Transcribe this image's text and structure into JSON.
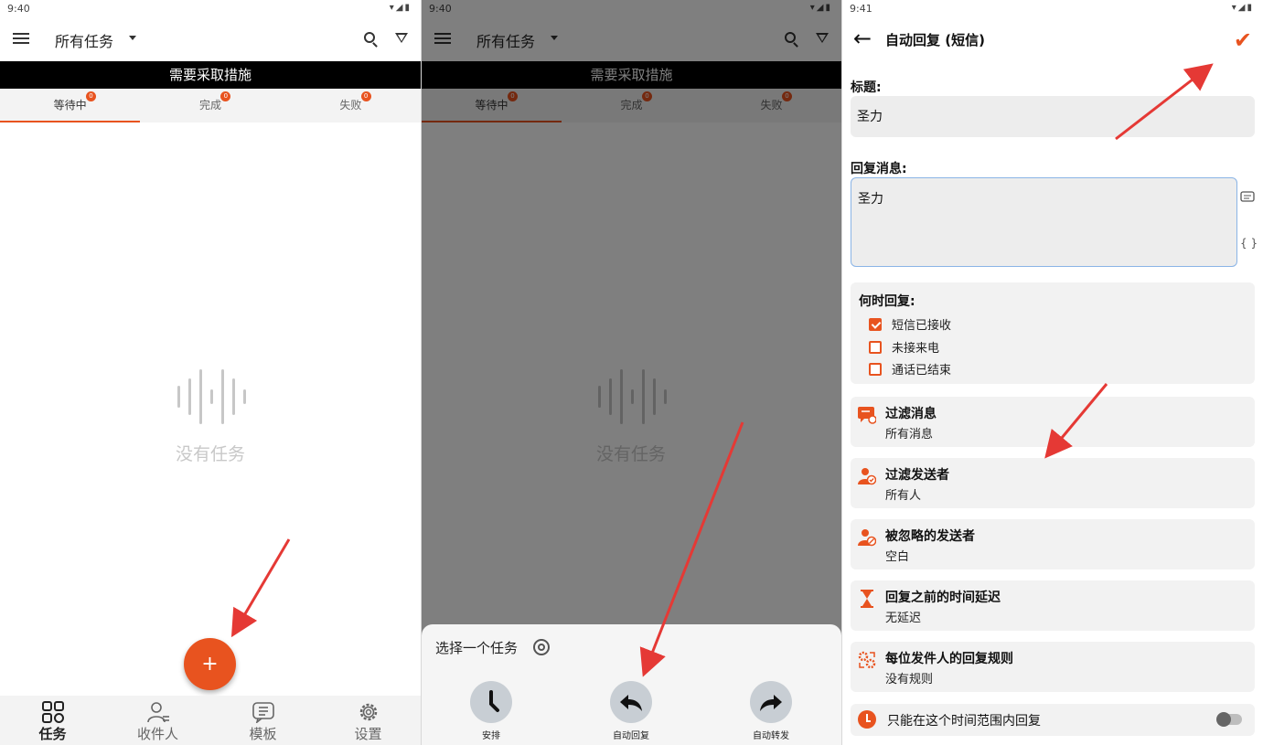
{
  "colors": {
    "accent": "#e8531f",
    "arrow": "#e53935"
  },
  "screen1": {
    "time": "9:40",
    "title": "所有任务",
    "action_banner": "需要采取措施",
    "tabs": [
      {
        "label": "等待中",
        "count": "0",
        "active": true
      },
      {
        "label": "完成",
        "count": "0"
      },
      {
        "label": "失败",
        "count": "0"
      }
    ],
    "empty_text": "没有任务",
    "fab": "+",
    "nav": [
      {
        "label": "任务",
        "icon": "grid-icon",
        "active": true
      },
      {
        "label": "收件人",
        "icon": "recipient-icon"
      },
      {
        "label": "模板",
        "icon": "template-icon"
      },
      {
        "label": "设置",
        "icon": "gear-icon"
      }
    ]
  },
  "screen2": {
    "time": "9:40",
    "title": "所有任务",
    "action_banner": "需要采取措施",
    "tabs": [
      {
        "label": "等待中",
        "count": "0"
      },
      {
        "label": "完成",
        "count": "0"
      },
      {
        "label": "失败",
        "count": "0"
      }
    ],
    "empty_text": "没有任务",
    "sheet_title": "选择一个任务",
    "sheet_options": [
      {
        "label": "安排",
        "icon": "clock-icon"
      },
      {
        "label": "自动回复",
        "icon": "reply-icon"
      },
      {
        "label": "自动转发",
        "icon": "forward-icon"
      }
    ]
  },
  "screen3": {
    "time": "9:41",
    "title": "自动回复 (短信)",
    "title_label": "标题:",
    "title_value": "圣力",
    "message_label": "回复消息:",
    "message_value": "圣力",
    "side_icon_2": "{ }",
    "when_label": "何时回复:",
    "when_options": [
      {
        "label": "短信已接收",
        "checked": true
      },
      {
        "label": "未接来电",
        "checked": false
      },
      {
        "label": "通话已结束",
        "checked": false
      }
    ],
    "options": [
      {
        "title": "过滤消息",
        "sub": "所有消息",
        "icon": "message-filter-icon"
      },
      {
        "title": "过滤发送者",
        "sub": "所有人",
        "icon": "sender-filter-icon"
      },
      {
        "title": "被忽略的发送者",
        "sub": "空白",
        "icon": "ignored-sender-icon"
      },
      {
        "title": "回复之前的时间延迟",
        "sub": "无延迟",
        "icon": "hourglass-icon"
      },
      {
        "title": "每位发件人的回复规则",
        "sub": "没有规则",
        "icon": "rules-icon"
      }
    ],
    "time_range_label": "只能在这个时间范围内回复",
    "time_range_enabled": false
  }
}
